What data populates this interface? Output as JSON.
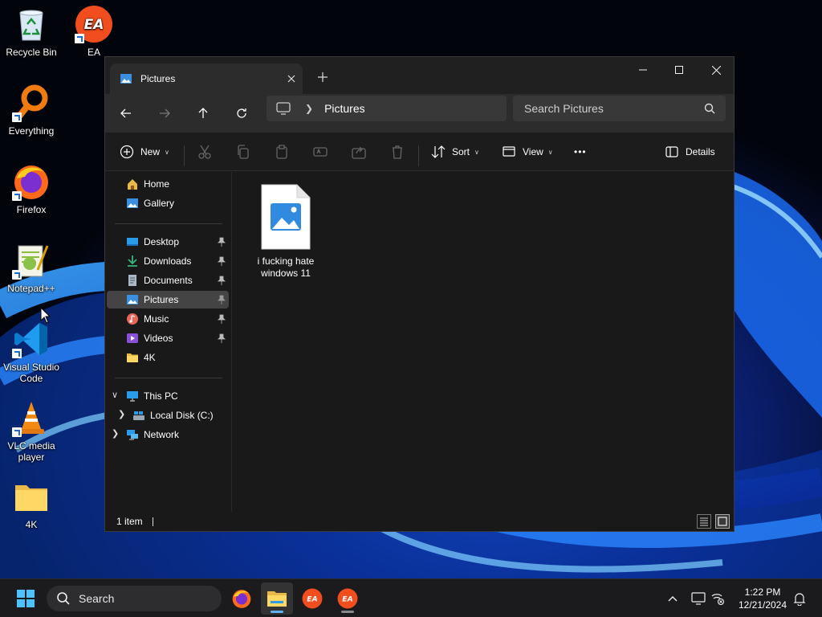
{
  "desktop": {
    "icons": [
      {
        "label": "Recycle Bin",
        "icon": "recycle-bin-icon"
      },
      {
        "label": "EA",
        "icon": "ea-icon"
      },
      {
        "label": "Everything",
        "icon": "everything-search-icon"
      },
      {
        "label": "Firefox",
        "icon": "firefox-icon"
      },
      {
        "label": "Notepad++",
        "icon": "notepad-plus-plus-icon"
      },
      {
        "label": "Visual Studio Code",
        "icon": "vscode-icon"
      },
      {
        "label": "VLC media player",
        "icon": "vlc-icon"
      },
      {
        "label": "4K",
        "icon": "folder-icon"
      }
    ]
  },
  "explorer": {
    "tab_title": "Pictures",
    "breadcrumb": "Pictures",
    "search_placeholder": "Search Pictures",
    "toolbar": {
      "new_label": "New",
      "sort_label": "Sort",
      "view_label": "View",
      "more_label": "•••",
      "details_label": "Details"
    },
    "nav": {
      "home": "Home",
      "gallery": "Gallery",
      "desktop": "Desktop",
      "downloads": "Downloads",
      "documents": "Documents",
      "pictures": "Pictures",
      "music": "Music",
      "videos": "Videos",
      "fourk": "4K",
      "this_pc": "This PC",
      "local_disk": "Local Disk (C:)",
      "network": "Network"
    },
    "files": [
      {
        "name": "i fucking hate windows 11",
        "icon": "image-file-icon"
      }
    ],
    "status": "1 item"
  },
  "taskbar": {
    "search_label": "Search",
    "time": "1:22 PM",
    "date": "12/21/2024"
  },
  "colors": {
    "accent": "#5fb2f2",
    "window_bg": "#191919",
    "selection": "#444444",
    "ea_orange": "#f04e1e"
  }
}
